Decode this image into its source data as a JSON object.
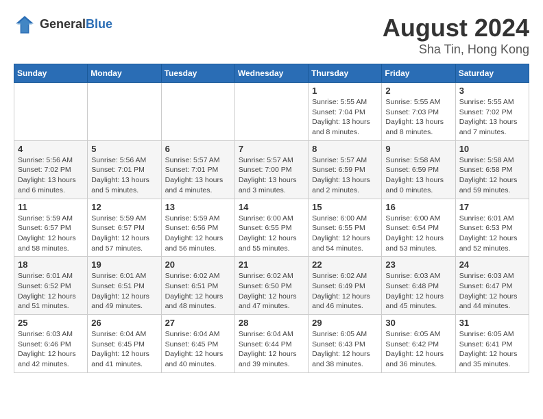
{
  "header": {
    "logo_general": "General",
    "logo_blue": "Blue",
    "title": "August 2024",
    "subtitle": "Sha Tin, Hong Kong"
  },
  "days_of_week": [
    "Sunday",
    "Monday",
    "Tuesday",
    "Wednesday",
    "Thursday",
    "Friday",
    "Saturday"
  ],
  "weeks": [
    [
      {
        "num": "",
        "detail": ""
      },
      {
        "num": "",
        "detail": ""
      },
      {
        "num": "",
        "detail": ""
      },
      {
        "num": "",
        "detail": ""
      },
      {
        "num": "1",
        "detail": "Sunrise: 5:55 AM\nSunset: 7:04 PM\nDaylight: 13 hours\nand 8 minutes."
      },
      {
        "num": "2",
        "detail": "Sunrise: 5:55 AM\nSunset: 7:03 PM\nDaylight: 13 hours\nand 8 minutes."
      },
      {
        "num": "3",
        "detail": "Sunrise: 5:55 AM\nSunset: 7:02 PM\nDaylight: 13 hours\nand 7 minutes."
      }
    ],
    [
      {
        "num": "4",
        "detail": "Sunrise: 5:56 AM\nSunset: 7:02 PM\nDaylight: 13 hours\nand 6 minutes."
      },
      {
        "num": "5",
        "detail": "Sunrise: 5:56 AM\nSunset: 7:01 PM\nDaylight: 13 hours\nand 5 minutes."
      },
      {
        "num": "6",
        "detail": "Sunrise: 5:57 AM\nSunset: 7:01 PM\nDaylight: 13 hours\nand 4 minutes."
      },
      {
        "num": "7",
        "detail": "Sunrise: 5:57 AM\nSunset: 7:00 PM\nDaylight: 13 hours\nand 3 minutes."
      },
      {
        "num": "8",
        "detail": "Sunrise: 5:57 AM\nSunset: 6:59 PM\nDaylight: 13 hours\nand 2 minutes."
      },
      {
        "num": "9",
        "detail": "Sunrise: 5:58 AM\nSunset: 6:59 PM\nDaylight: 13 hours\nand 0 minutes."
      },
      {
        "num": "10",
        "detail": "Sunrise: 5:58 AM\nSunset: 6:58 PM\nDaylight: 12 hours\nand 59 minutes."
      }
    ],
    [
      {
        "num": "11",
        "detail": "Sunrise: 5:59 AM\nSunset: 6:57 PM\nDaylight: 12 hours\nand 58 minutes."
      },
      {
        "num": "12",
        "detail": "Sunrise: 5:59 AM\nSunset: 6:57 PM\nDaylight: 12 hours\nand 57 minutes."
      },
      {
        "num": "13",
        "detail": "Sunrise: 5:59 AM\nSunset: 6:56 PM\nDaylight: 12 hours\nand 56 minutes."
      },
      {
        "num": "14",
        "detail": "Sunrise: 6:00 AM\nSunset: 6:55 PM\nDaylight: 12 hours\nand 55 minutes."
      },
      {
        "num": "15",
        "detail": "Sunrise: 6:00 AM\nSunset: 6:55 PM\nDaylight: 12 hours\nand 54 minutes."
      },
      {
        "num": "16",
        "detail": "Sunrise: 6:00 AM\nSunset: 6:54 PM\nDaylight: 12 hours\nand 53 minutes."
      },
      {
        "num": "17",
        "detail": "Sunrise: 6:01 AM\nSunset: 6:53 PM\nDaylight: 12 hours\nand 52 minutes."
      }
    ],
    [
      {
        "num": "18",
        "detail": "Sunrise: 6:01 AM\nSunset: 6:52 PM\nDaylight: 12 hours\nand 51 minutes."
      },
      {
        "num": "19",
        "detail": "Sunrise: 6:01 AM\nSunset: 6:51 PM\nDaylight: 12 hours\nand 49 minutes."
      },
      {
        "num": "20",
        "detail": "Sunrise: 6:02 AM\nSunset: 6:51 PM\nDaylight: 12 hours\nand 48 minutes."
      },
      {
        "num": "21",
        "detail": "Sunrise: 6:02 AM\nSunset: 6:50 PM\nDaylight: 12 hours\nand 47 minutes."
      },
      {
        "num": "22",
        "detail": "Sunrise: 6:02 AM\nSunset: 6:49 PM\nDaylight: 12 hours\nand 46 minutes."
      },
      {
        "num": "23",
        "detail": "Sunrise: 6:03 AM\nSunset: 6:48 PM\nDaylight: 12 hours\nand 45 minutes."
      },
      {
        "num": "24",
        "detail": "Sunrise: 6:03 AM\nSunset: 6:47 PM\nDaylight: 12 hours\nand 44 minutes."
      }
    ],
    [
      {
        "num": "25",
        "detail": "Sunrise: 6:03 AM\nSunset: 6:46 PM\nDaylight: 12 hours\nand 42 minutes."
      },
      {
        "num": "26",
        "detail": "Sunrise: 6:04 AM\nSunset: 6:45 PM\nDaylight: 12 hours\nand 41 minutes."
      },
      {
        "num": "27",
        "detail": "Sunrise: 6:04 AM\nSunset: 6:45 PM\nDaylight: 12 hours\nand 40 minutes."
      },
      {
        "num": "28",
        "detail": "Sunrise: 6:04 AM\nSunset: 6:44 PM\nDaylight: 12 hours\nand 39 minutes."
      },
      {
        "num": "29",
        "detail": "Sunrise: 6:05 AM\nSunset: 6:43 PM\nDaylight: 12 hours\nand 38 minutes."
      },
      {
        "num": "30",
        "detail": "Sunrise: 6:05 AM\nSunset: 6:42 PM\nDaylight: 12 hours\nand 36 minutes."
      },
      {
        "num": "31",
        "detail": "Sunrise: 6:05 AM\nSunset: 6:41 PM\nDaylight: 12 hours\nand 35 minutes."
      }
    ]
  ]
}
